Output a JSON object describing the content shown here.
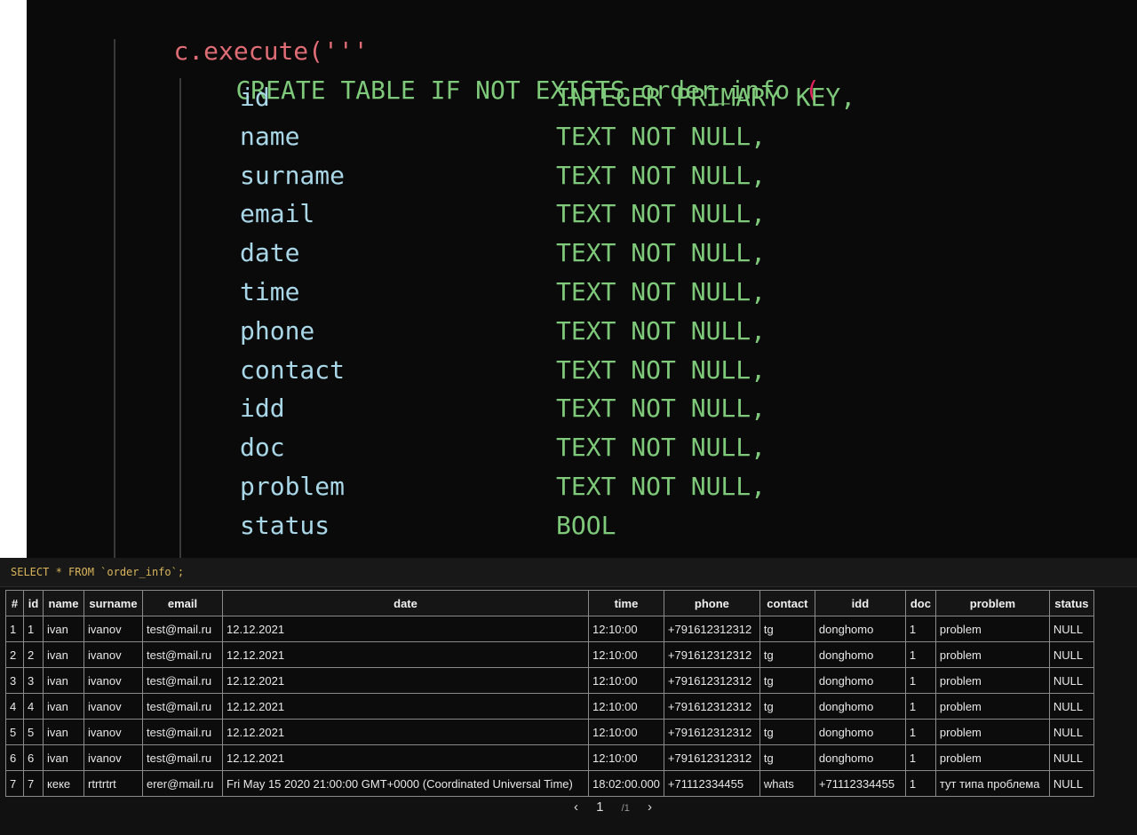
{
  "code": {
    "line1": "c.execute('''",
    "create_statement": "CREATE TABLE IF NOT EXISTS order_info",
    "open_paren": "(",
    "columns": [
      {
        "name": "id",
        "type": "INTEGER PRIMARY KEY,"
      },
      {
        "name": "name",
        "type": "TEXT NOT NULL,"
      },
      {
        "name": "surname",
        "type": "TEXT NOT NULL,"
      },
      {
        "name": "email",
        "type": "TEXT NOT NULL,"
      },
      {
        "name": "date",
        "type": "TEXT NOT NULL,"
      },
      {
        "name": "time",
        "type": "TEXT NOT NULL,"
      },
      {
        "name": "phone",
        "type": "TEXT NOT NULL,"
      },
      {
        "name": "contact",
        "type": "TEXT NOT NULL,"
      },
      {
        "name": "idd",
        "type": "TEXT NOT NULL,"
      },
      {
        "name": "doc",
        "type": "TEXT NOT NULL,"
      },
      {
        "name": "problem",
        "type": "TEXT NOT NULL,"
      },
      {
        "name": "status",
        "type": "BOOL"
      }
    ]
  },
  "query": {
    "text": "SELECT * FROM `order_info`;"
  },
  "table": {
    "headers": [
      "#",
      "id",
      "name",
      "surname",
      "email",
      "date",
      "time",
      "phone",
      "contact",
      "idd",
      "doc",
      "problem",
      "status"
    ],
    "rows": [
      [
        "1",
        "1",
        "ivan",
        "ivanov",
        "test@mail.ru",
        "12.12.2021",
        "12:10:00",
        "+791612312312",
        "tg",
        "donghomo",
        "1",
        "problem",
        "NULL"
      ],
      [
        "2",
        "2",
        "ivan",
        "ivanov",
        "test@mail.ru",
        "12.12.2021",
        "12:10:00",
        "+791612312312",
        "tg",
        "donghomo",
        "1",
        "problem",
        "NULL"
      ],
      [
        "3",
        "3",
        "ivan",
        "ivanov",
        "test@mail.ru",
        "12.12.2021",
        "12:10:00",
        "+791612312312",
        "tg",
        "donghomo",
        "1",
        "problem",
        "NULL"
      ],
      [
        "4",
        "4",
        "ivan",
        "ivanov",
        "test@mail.ru",
        "12.12.2021",
        "12:10:00",
        "+791612312312",
        "tg",
        "donghomo",
        "1",
        "problem",
        "NULL"
      ],
      [
        "5",
        "5",
        "ivan",
        "ivanov",
        "test@mail.ru",
        "12.12.2021",
        "12:10:00",
        "+791612312312",
        "tg",
        "donghomo",
        "1",
        "problem",
        "NULL"
      ],
      [
        "6",
        "6",
        "ivan",
        "ivanov",
        "test@mail.ru",
        "12.12.2021",
        "12:10:00",
        "+791612312312",
        "tg",
        "donghomo",
        "1",
        "problem",
        "NULL"
      ],
      [
        "7",
        "7",
        "кеке",
        "rtrtrtrt",
        "erer@mail.ru",
        "Fri May 15 2020 21:00:00 GMT+0000 (Coordinated Universal Time)",
        "18:02:00.000",
        "+71112334455",
        "whats",
        "+71112334455",
        "1",
        "тут типа проблема",
        "NULL"
      ]
    ]
  },
  "pagination": {
    "prev": "‹",
    "current": "1",
    "total": "/1",
    "next": "›"
  }
}
